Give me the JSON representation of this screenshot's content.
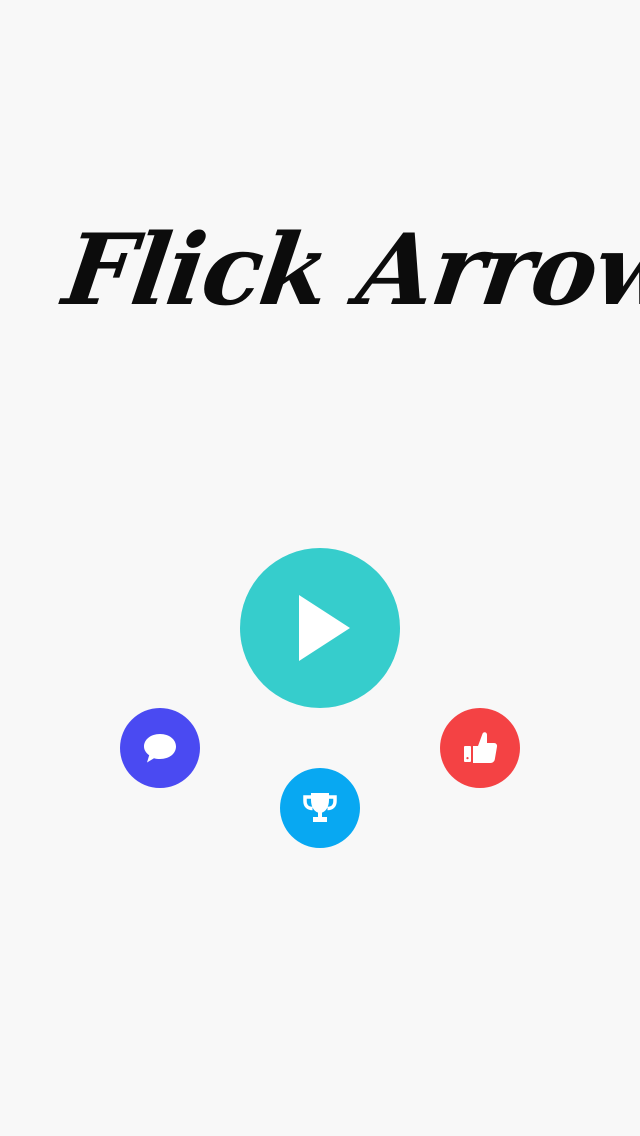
{
  "app": {
    "title": "Flick Arrow"
  },
  "colors": {
    "background": "#f8f8f8",
    "title_text": "#0c0c0c",
    "play_button": "#36cdcc",
    "chat_button": "#4a4af2",
    "trophy_button": "#08a8f2",
    "like_button": "#f44244",
    "icon": "#ffffff"
  },
  "buttons": {
    "play": {
      "icon": "play-icon"
    },
    "chat": {
      "icon": "speech-bubble-icon"
    },
    "trophy": {
      "icon": "trophy-icon"
    },
    "like": {
      "icon": "thumbs-up-icon"
    }
  }
}
